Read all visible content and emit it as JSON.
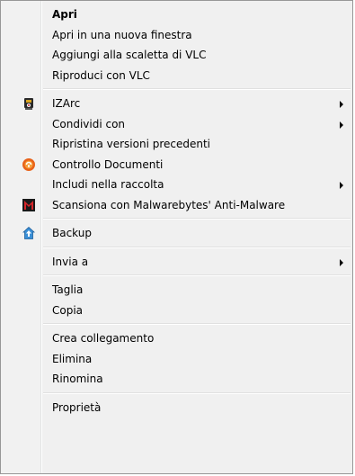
{
  "menu": {
    "items": [
      {
        "label": "Apri",
        "bold": true
      },
      {
        "label": "Apri in una nuova finestra"
      },
      {
        "label": "Aggiungi alla scaletta di VLC"
      },
      {
        "label": "Riproduci con VLC"
      },
      {
        "label": "IZArc",
        "icon": "izarc-icon",
        "submenu": true
      },
      {
        "label": "Condividi con",
        "submenu": true
      },
      {
        "label": "Ripristina versioni precedenti"
      },
      {
        "label": "Controllo Documenti",
        "icon": "controllo-documenti-icon"
      },
      {
        "label": "Includi nella raccolta",
        "submenu": true
      },
      {
        "label": "Scansiona con Malwarebytes' Anti-Malware",
        "icon": "malwarebytes-icon"
      },
      {
        "label": "Backup",
        "icon": "backup-icon"
      },
      {
        "label": "Invia a",
        "submenu": true
      },
      {
        "label": "Taglia"
      },
      {
        "label": "Copia"
      },
      {
        "label": "Crea collegamento"
      },
      {
        "label": "Elimina"
      },
      {
        "label": "Rinomina"
      },
      {
        "label": "Proprietà"
      }
    ]
  },
  "colors": {
    "menu_background": "#f0f0f0",
    "border": "#979797",
    "separator": "#e0e0e0"
  }
}
